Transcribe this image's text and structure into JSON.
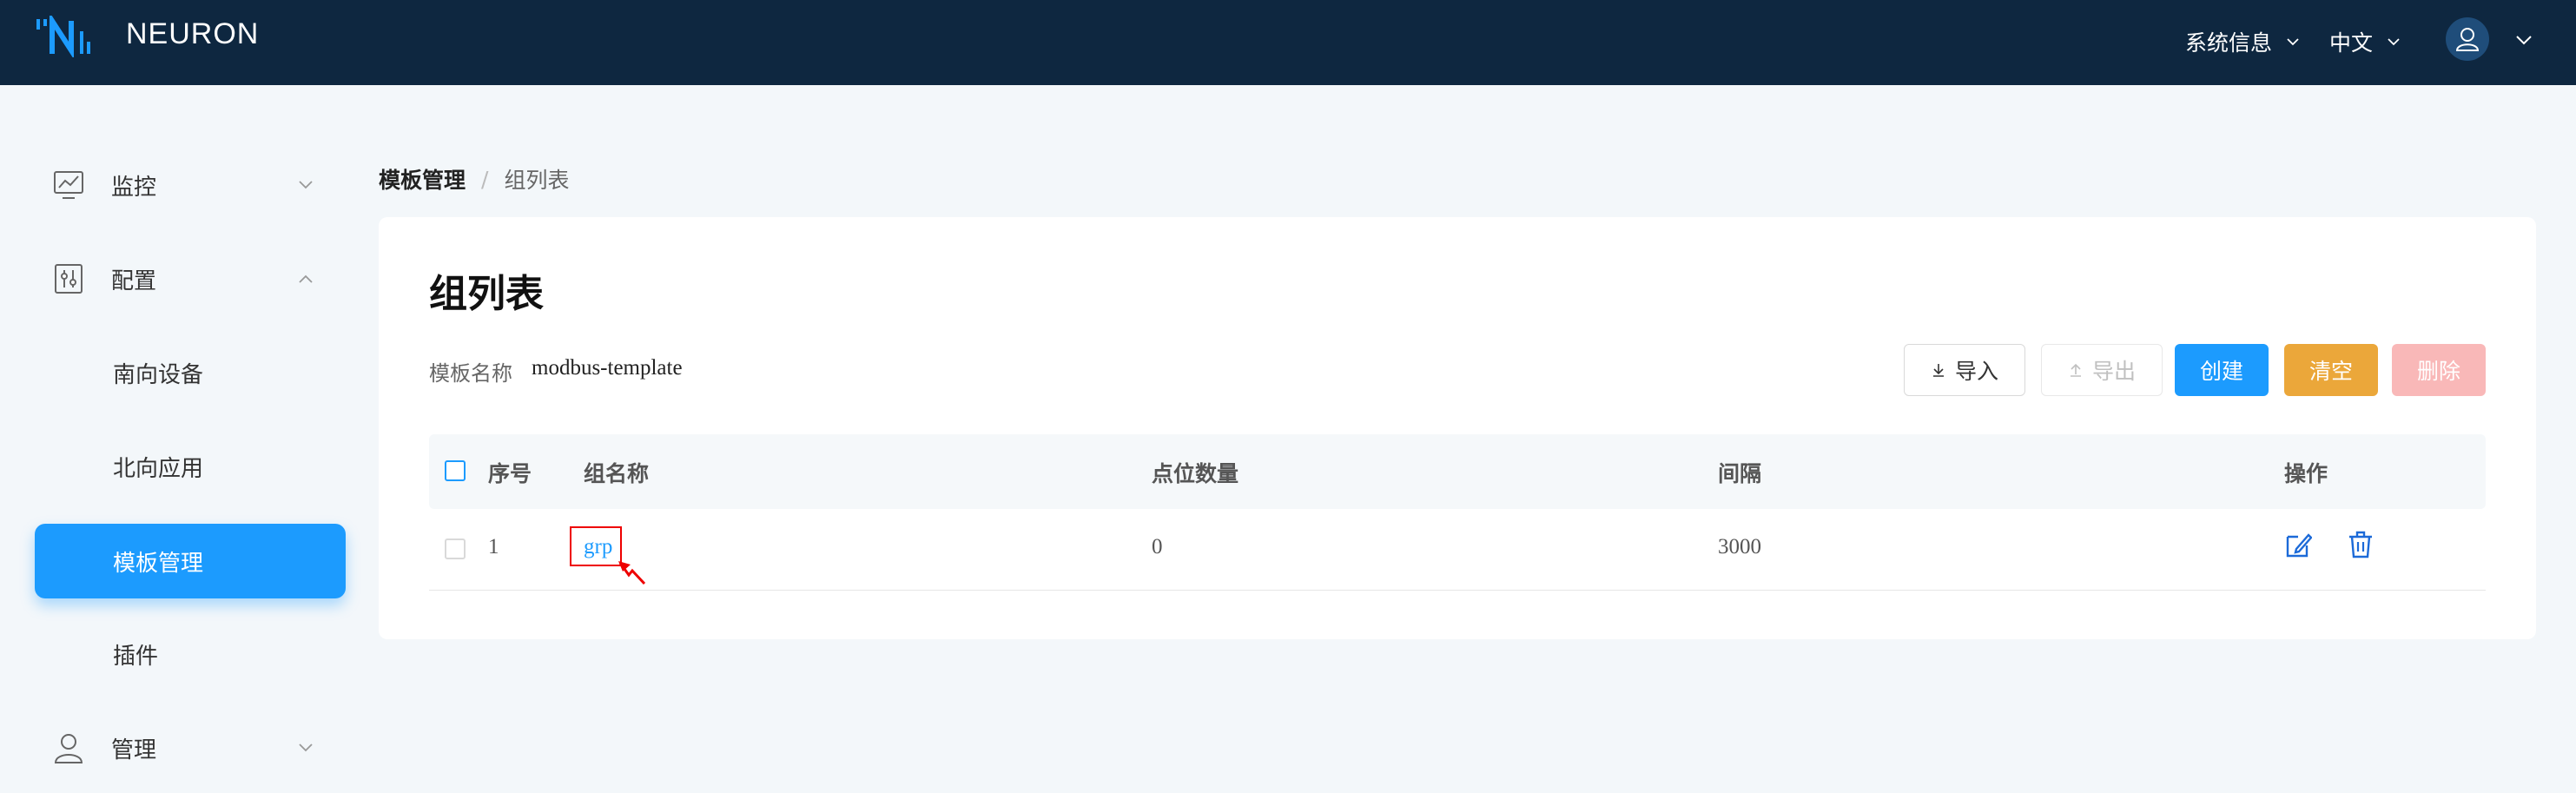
{
  "header": {
    "brand": "NEURON",
    "system_info": "系统信息",
    "language": "中文"
  },
  "sidebar": {
    "items": [
      {
        "label": "监控"
      },
      {
        "label": "配置"
      },
      {
        "label": "南向设备"
      },
      {
        "label": "北向应用"
      },
      {
        "label": "模板管理"
      },
      {
        "label": "插件"
      },
      {
        "label": "管理"
      }
    ]
  },
  "breadcrumb": {
    "parent": "模板管理",
    "separator": "/",
    "current": "组列表"
  },
  "page": {
    "title": "组列表",
    "template_label": "模板名称",
    "template_name": "modbus-template"
  },
  "toolbar": {
    "import_label": "导入",
    "export_label": "导出",
    "create_label": "创建",
    "clear_label": "清空",
    "delete_label": "删除"
  },
  "table": {
    "headers": {
      "index": "序号",
      "group_name": "组名称",
      "tag_count": "点位数量",
      "interval": "间隔",
      "actions": "操作"
    },
    "rows": [
      {
        "index": "1",
        "group_name": "grp",
        "tag_count": "0",
        "interval": "3000"
      }
    ]
  },
  "colors": {
    "header_bg": "#0e2740",
    "primary": "#1c9bfe",
    "warning": "#eba73a",
    "danger_disabled": "#f9b8b8"
  }
}
